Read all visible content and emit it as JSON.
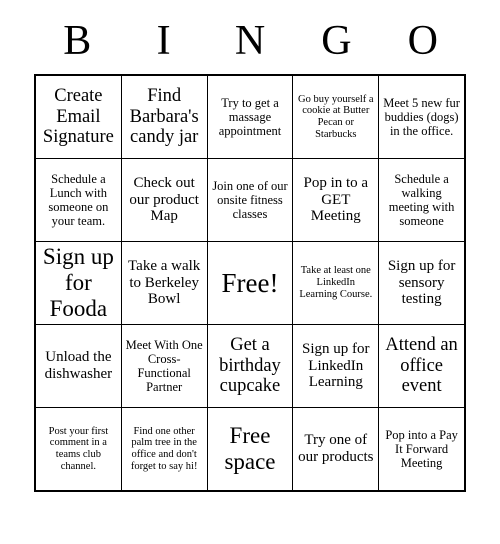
{
  "header": {
    "letters": [
      "B",
      "I",
      "N",
      "G",
      "O"
    ]
  },
  "grid": {
    "columns": 5,
    "rows": 5,
    "cells": [
      [
        {
          "text": "Create Email Signature",
          "size": "fs-large"
        },
        {
          "text": "Find Barbara's candy jar",
          "size": "fs-large"
        },
        {
          "text": "Try to get a massage appointment",
          "size": "fs-small"
        },
        {
          "text": "Go buy yourself a cookie at Butter Pecan or Starbucks",
          "size": "fs-xsmall"
        },
        {
          "text": "Meet 5 new fur buddies (dogs) in the office.",
          "size": "fs-small"
        }
      ],
      [
        {
          "text": "Schedule a Lunch with someone on your team.",
          "size": "fs-small"
        },
        {
          "text": "Check out our product Map",
          "size": "fs-medium"
        },
        {
          "text": "Join one of our onsite fitness classes",
          "size": "fs-small"
        },
        {
          "text": "Pop in to a GET Meeting",
          "size": "fs-medium"
        },
        {
          "text": "Schedule a walking meeting with someone",
          "size": "fs-small"
        }
      ],
      [
        {
          "text": "Sign up for Fooda",
          "size": "fs-xlarge"
        },
        {
          "text": "Take a walk to Berkeley Bowl",
          "size": "fs-medium"
        },
        {
          "text": "Free!",
          "size": "fs-free"
        },
        {
          "text": "Take at least one LinkedIn Learning Course.",
          "size": "fs-xsmall"
        },
        {
          "text": "Sign up for sensory testing",
          "size": "fs-medium"
        }
      ],
      [
        {
          "text": "Unload the dishwasher",
          "size": "fs-medium"
        },
        {
          "text": "Meet With One Cross-Functional Partner",
          "size": "fs-small"
        },
        {
          "text": "Get a birthday cupcake",
          "size": "fs-large"
        },
        {
          "text": "Sign up for LinkedIn Learning",
          "size": "fs-medium"
        },
        {
          "text": "Attend an office event",
          "size": "fs-large"
        }
      ],
      [
        {
          "text": "Post your first comment in a teams club channel.",
          "size": "fs-xsmall"
        },
        {
          "text": "Find one other palm tree in the office and don't forget to say hi!",
          "size": "fs-xsmall"
        },
        {
          "text": "Free space",
          "size": "fs-xlarge"
        },
        {
          "text": "Try one of our products",
          "size": "fs-medium"
        },
        {
          "text": "Pop into a Pay It Forward Meeting",
          "size": "fs-small"
        }
      ]
    ]
  }
}
